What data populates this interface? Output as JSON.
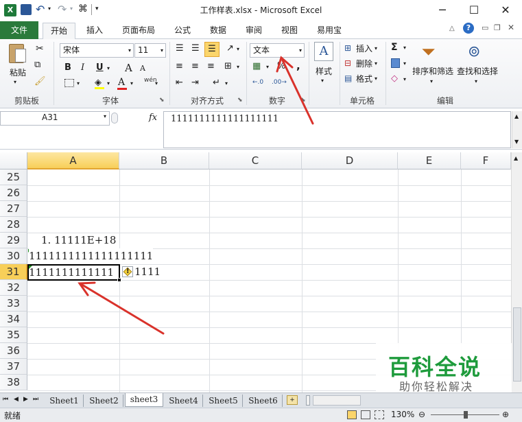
{
  "window": {
    "title": "工作样表.xlsx - Microsoft Excel",
    "minimize": "─",
    "maximize": "☐",
    "close": "✕"
  },
  "tabs": [
    "文件",
    "开始",
    "插入",
    "页面布局",
    "公式",
    "数据",
    "审阅",
    "视图",
    "易用宝"
  ],
  "ribbon": {
    "clipboard": {
      "paste": "粘贴",
      "label": "剪贴板"
    },
    "font": {
      "name": "宋体",
      "size": "11",
      "label": "字体",
      "bold": "B",
      "italic": "I",
      "underline": "U",
      "grow": "A",
      "shrink": "A",
      "fontcolor": "A",
      "phonetic": "wén"
    },
    "alignment": {
      "label": "对齐方式"
    },
    "number": {
      "format": "文本",
      "label": "数字",
      "percent": "%",
      "comma": ","
    },
    "styles": {
      "label": "样式"
    },
    "cells": {
      "insert": "插入",
      "delete": "删除",
      "format": "格式",
      "label": "单元格"
    },
    "editing": {
      "sort": "排序和筛选",
      "find": "查找和选择",
      "label": "编辑",
      "sum": "Σ"
    }
  },
  "formula_bar": {
    "name_box": "A31",
    "fx": "fx",
    "value": "1111111111111111111"
  },
  "grid": {
    "columns": [
      "A",
      "B",
      "C",
      "D",
      "E",
      "F"
    ],
    "selected_column": "A",
    "rows": [
      "25",
      "26",
      "27",
      "28",
      "29",
      "30",
      "31",
      "32",
      "33",
      "34",
      "35",
      "36",
      "37",
      "38"
    ],
    "selected_row": "31",
    "cells": {
      "A29": "1. 11111E+18",
      "A30": "1111111111111111111",
      "A31_visible": "1111111111111",
      "A31_overflow": "1111"
    }
  },
  "sheets": [
    "Sheet1",
    "Sheet2",
    "sheet3",
    "Sheet4",
    "Sheet5",
    "Sheet6"
  ],
  "active_sheet": "sheet3",
  "status": {
    "ready": "就绪",
    "zoom": "130%"
  },
  "watermark": {
    "title": "百科全说",
    "subtitle": "助你轻松解决"
  },
  "colors": {
    "file_tab": "#2a7a3b",
    "selection_header": "#f8cf59",
    "annotation_arrow": "#d9322b",
    "watermark_green": "#1e9b3c"
  }
}
